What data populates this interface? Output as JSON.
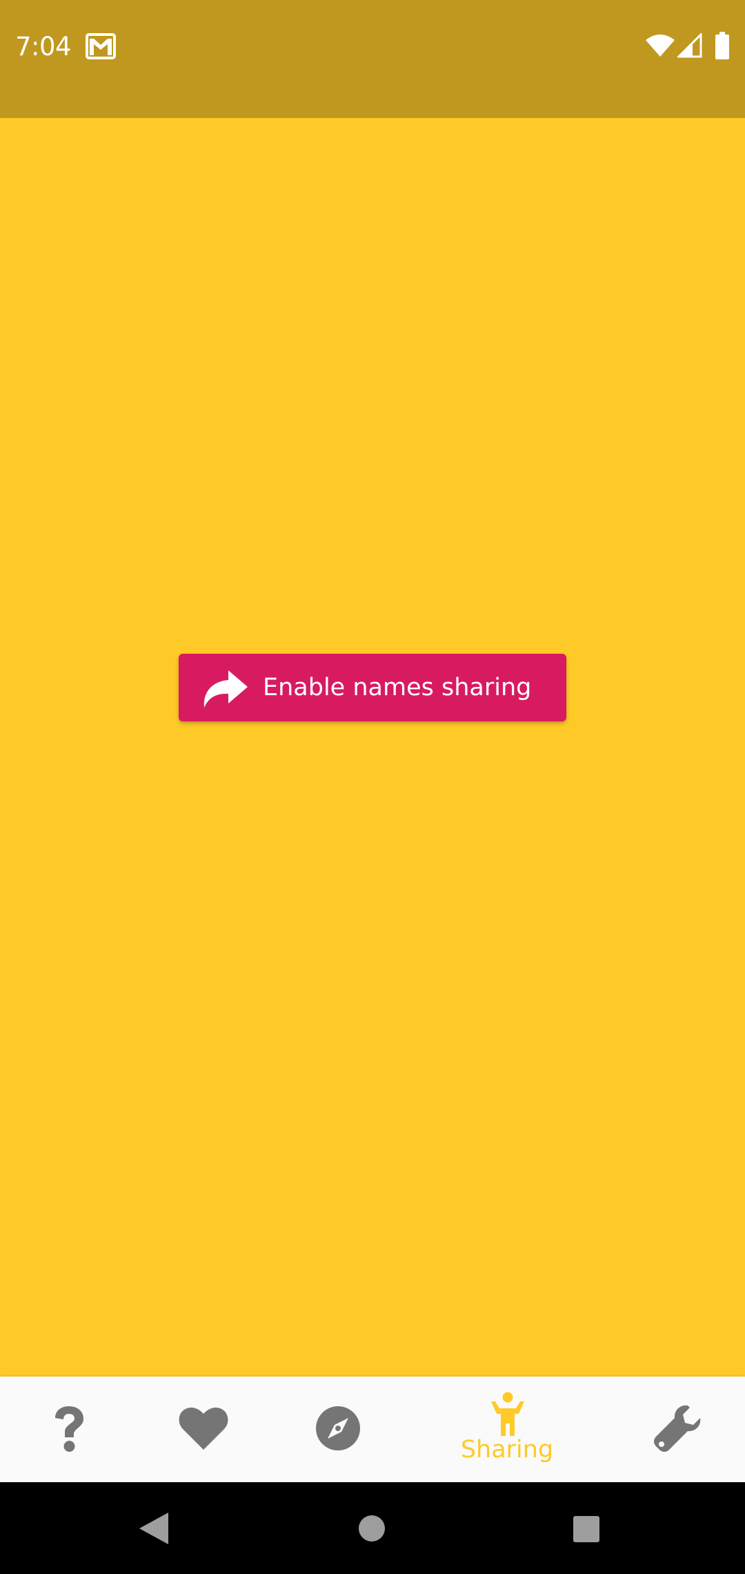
{
  "status_bar": {
    "time": "7:04",
    "icons": [
      "gmail-notification-icon",
      "wifi-icon",
      "cell-signal-icon",
      "battery-icon"
    ],
    "background_color": "#C0981F"
  },
  "main": {
    "background_color": "#FFCA28",
    "enable_sharing_button": {
      "label": "Enable names sharing",
      "icon": "share-arrow-icon",
      "color": "#D81B60"
    }
  },
  "bottom_nav": {
    "items": [
      {
        "icon": "question-mark-icon",
        "label": "",
        "selected": false
      },
      {
        "icon": "heart-icon",
        "label": "",
        "selected": false
      },
      {
        "icon": "compass-icon",
        "label": "",
        "selected": false
      },
      {
        "icon": "person-icon",
        "label": "Sharing",
        "selected": true
      },
      {
        "icon": "wrench-icon",
        "label": "",
        "selected": false
      }
    ],
    "active_color": "#FFCA28",
    "inactive_color": "#757575"
  },
  "system_nav": {
    "buttons": [
      "back-icon",
      "home-icon",
      "recents-icon"
    ]
  }
}
